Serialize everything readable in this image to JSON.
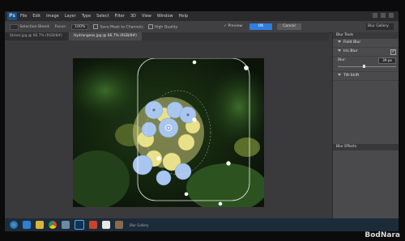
{
  "menubar": {
    "app_logo": "Ps",
    "items": [
      "File",
      "Edit",
      "Image",
      "Layer",
      "Type",
      "Select",
      "Filter",
      "3D",
      "View",
      "Window",
      "Help"
    ]
  },
  "options": {
    "selection_bleed_label": "Selection Bleed:",
    "focus_label": "Focus:",
    "focus_value": "100%",
    "save_mask_label": "Save Mask to Channels",
    "high_quality_label": "High Quality",
    "preview_label": "Preview",
    "ok_label": "OK",
    "cancel_label": "Cancel",
    "workspace_label": "Blur Gallery"
  },
  "tabs": [
    {
      "label": "Street.jpg @ 66.7% (RGB/8#)",
      "active": false
    },
    {
      "label": "Hydrangeas.jpg @ 66.7% (RGB/8#)",
      "active": true
    }
  ],
  "panel": {
    "tools_title": "Blur Tools",
    "field_blur": "Field Blur",
    "iris_blur": "Iris Blur",
    "iris_checked": "✓",
    "blur_label": "Blur:",
    "blur_value": "39 px",
    "blur_level": 0.45,
    "tilt_shift": "Tilt-Shift",
    "effects_title": "Blur Effects"
  },
  "taskbar": {
    "pinned_label": "Blur Gallery",
    "icons": [
      "start-icon",
      "ie-icon",
      "explorer-icon",
      "chrome-icon",
      "monitor-icon",
      "photoshop-icon",
      "powerpoint-icon",
      "vlc-icon",
      "tools-icon"
    ]
  },
  "watermark": "BodNara",
  "colors": {
    "accent": "#2f7de1",
    "panel_bg": "#4a4a4c",
    "workspace_bg": "#3a3a3c",
    "taskbar_bg": "#1c2b3a"
  }
}
